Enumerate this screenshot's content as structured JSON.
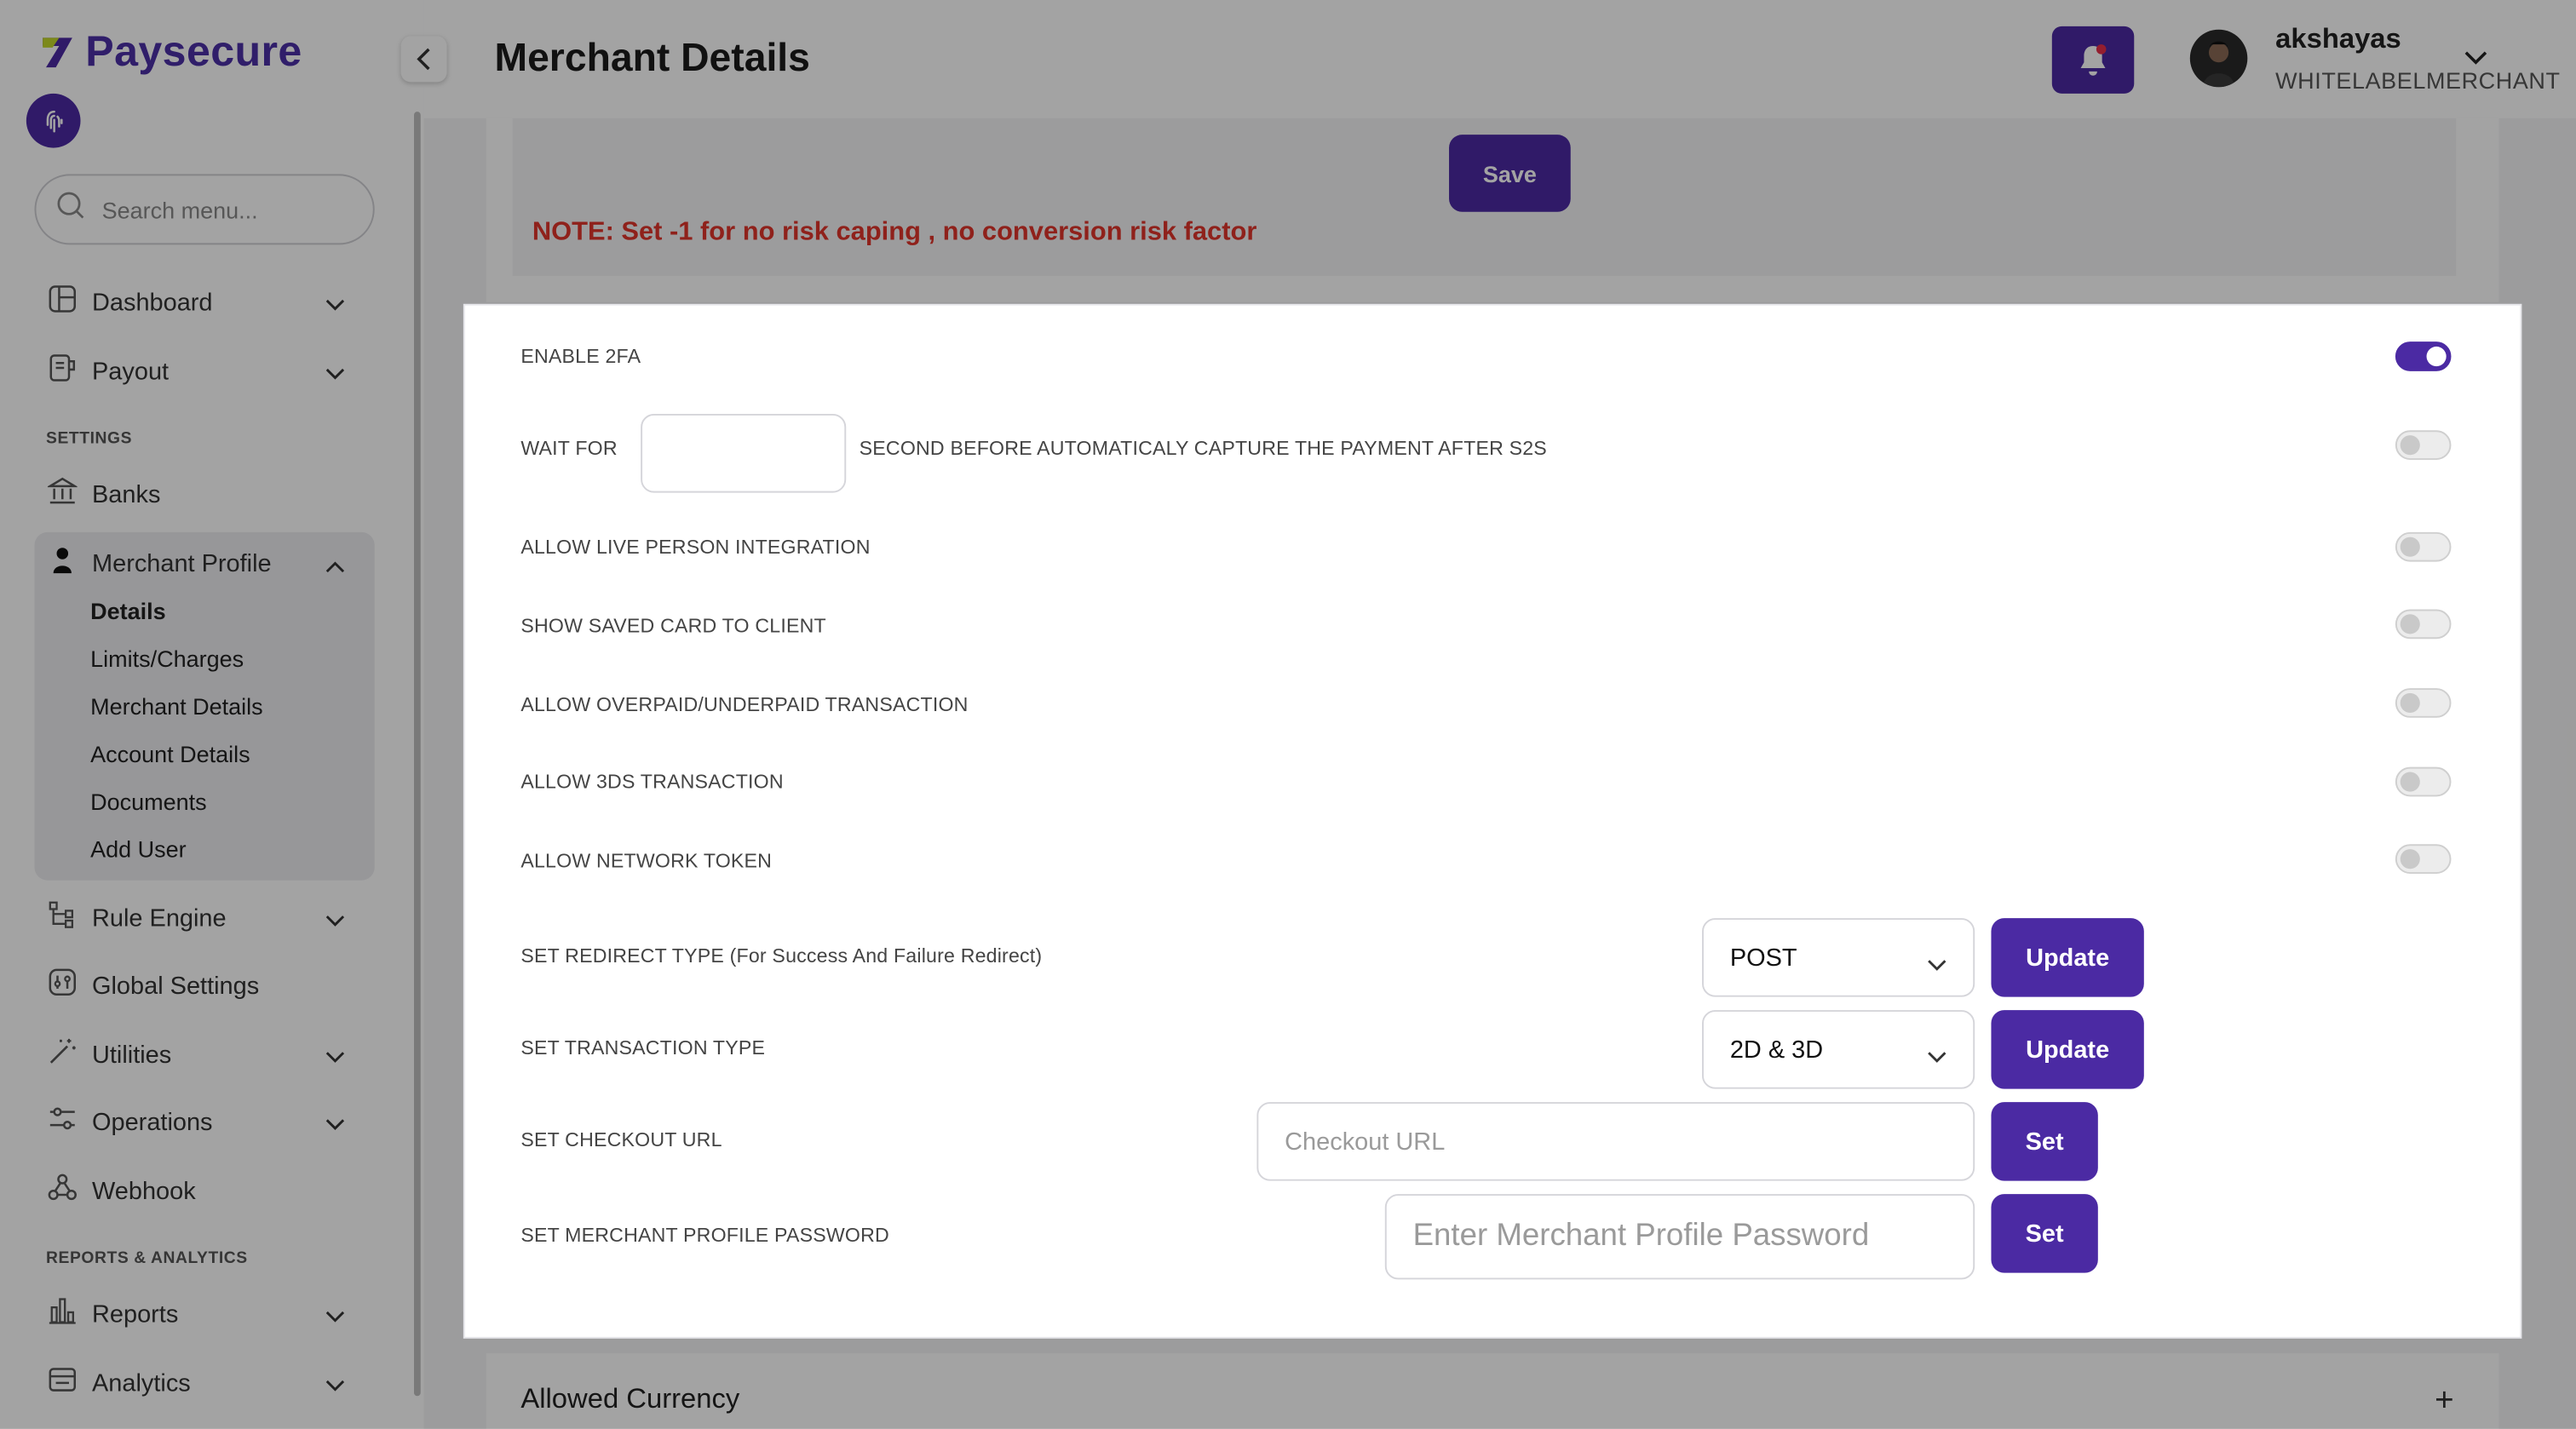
{
  "brand": {
    "name": "Paysecure"
  },
  "sidebar": {
    "search_placeholder": "Search menu...",
    "items": [
      {
        "label": "Dashboard"
      },
      {
        "label": "Payout"
      },
      {
        "label": "Banks"
      },
      {
        "label": "Merchant Profile"
      },
      {
        "label": "Rule Engine"
      },
      {
        "label": "Global Settings"
      },
      {
        "label": "Utilities"
      },
      {
        "label": "Operations"
      },
      {
        "label": "Webhook"
      },
      {
        "label": "Reports"
      },
      {
        "label": "Analytics"
      }
    ],
    "sections": {
      "settings": "SETTINGS",
      "reports": "REPORTS & ANALYTICS"
    },
    "merchant_sub": [
      {
        "label": "Details"
      },
      {
        "label": "Limits/Charges"
      },
      {
        "label": "Merchant Details"
      },
      {
        "label": "Account Details"
      },
      {
        "label": "Documents"
      },
      {
        "label": "Add User"
      }
    ]
  },
  "header": {
    "title": "Merchant Details",
    "user_name": "akshayas",
    "user_role": "WHITELABELMERCHANT"
  },
  "note": {
    "save_label": "Save",
    "text": "NOTE: Set -1 for no risk caping , no conversion risk factor"
  },
  "settings": {
    "enable_2fa": {
      "label": "ENABLE 2FA",
      "on": true
    },
    "wait_for": {
      "label_a": "WAIT FOR",
      "value": "",
      "label_b": "SECOND BEFORE AUTOMATICALY CAPTURE THE PAYMENT AFTER S2S",
      "on": false
    },
    "live_person": {
      "label": "ALLOW LIVE PERSON INTEGRATION",
      "on": false
    },
    "saved_card": {
      "label": "SHOW SAVED CARD TO CLIENT",
      "on": false
    },
    "overpaid": {
      "label": "ALLOW OVERPAID/UNDERPAID TRANSACTION",
      "on": false
    },
    "three_ds": {
      "label": "ALLOW 3DS TRANSACTION",
      "on": false
    },
    "network_token": {
      "label": "ALLOW NETWORK TOKEN",
      "on": false
    },
    "redirect_type": {
      "label": "SET REDIRECT TYPE (For Success And Failure Redirect)",
      "value": "POST",
      "button": "Update"
    },
    "transaction_type": {
      "label": "SET TRANSACTION TYPE",
      "value": "2D & 3D",
      "button": "Update"
    },
    "checkout_url": {
      "label": "SET CHECKOUT URL",
      "value": "",
      "placeholder": "Checkout URL",
      "button": "Set"
    },
    "profile_password": {
      "label": "SET MERCHANT PROFILE PASSWORD",
      "value": "",
      "placeholder": "Enter Merchant Profile Password",
      "button": "Set"
    }
  },
  "currency": {
    "title": "Allowed Currency"
  },
  "colors": {
    "primary": "#4b2aa3",
    "note_red": "#e0352b"
  }
}
